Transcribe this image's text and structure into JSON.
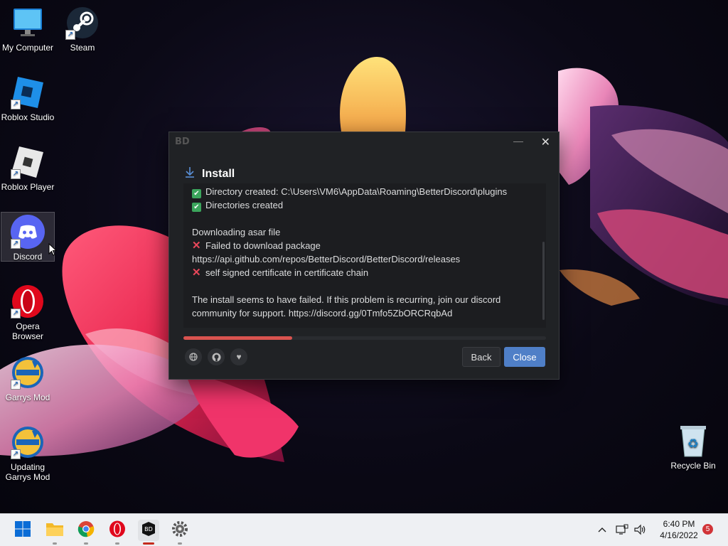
{
  "desktop": {
    "icons": [
      {
        "label": "My Computer",
        "icon": "monitor-icon"
      },
      {
        "label": "Steam",
        "icon": "steam-icon"
      },
      {
        "label": "Roblox Studio",
        "icon": "roblox-studio-icon"
      },
      {
        "label": "Roblox Player",
        "icon": "roblox-player-icon"
      },
      {
        "label": "Discord",
        "icon": "discord-icon"
      },
      {
        "label": "Opera Browser",
        "icon": "opera-icon"
      },
      {
        "label": "Garrys Mod",
        "icon": "garrys-mod-icon"
      },
      {
        "label": "Updating Garrys Mod",
        "icon": "garrys-mod-icon"
      },
      {
        "label": "Recycle Bin",
        "icon": "recycle-bin-icon"
      }
    ]
  },
  "installer": {
    "logo": "BD",
    "heading": "Install",
    "log": [
      {
        "status": "ok",
        "text": "Directory created: C:\\Users\\VM6\\AppData\\Roaming\\BetterDiscord\\plugins"
      },
      {
        "status": "ok",
        "text": "Directories created"
      },
      {
        "status": "none",
        "text": ""
      },
      {
        "status": "none",
        "text": "Downloading asar file"
      },
      {
        "status": "fail",
        "text": "Failed to download package"
      },
      {
        "status": "none",
        "text": "https://api.github.com/repos/BetterDiscord/BetterDiscord/releases"
      },
      {
        "status": "fail",
        "text": "self signed certificate in certificate chain"
      },
      {
        "status": "none",
        "text": ""
      },
      {
        "status": "none",
        "text": "The install seems to have failed. If this problem is recurring, join our discord"
      },
      {
        "status": "none",
        "text": "community for support. https://discord.gg/0Tmfo5ZbORCRqbAd"
      }
    ],
    "progress": 0.3,
    "progress_color": "#d9534f",
    "back_label": "Back",
    "close_label": "Close",
    "footer_icons": [
      "globe-icon",
      "github-icon",
      "heart-icon"
    ]
  },
  "taskbar": {
    "apps": [
      "start-icon",
      "file-explorer-icon",
      "chrome-icon",
      "opera-icon",
      "betterdiscord-icon",
      "settings-icon"
    ],
    "time": "6:40 PM",
    "date": "4/16/2022",
    "notifications": "5"
  }
}
